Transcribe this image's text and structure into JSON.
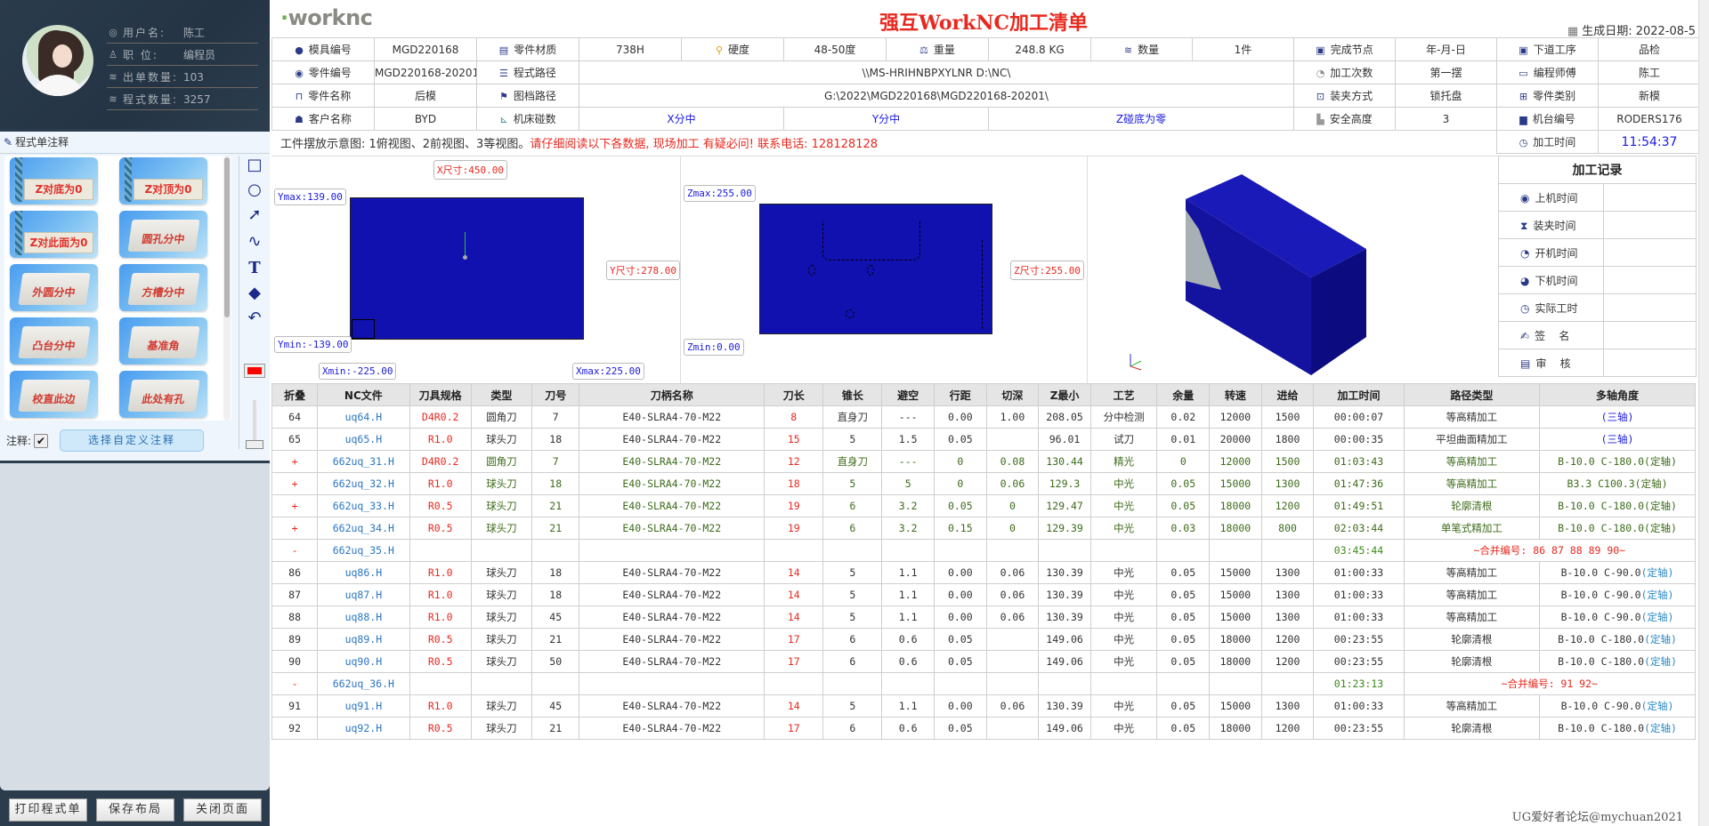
{
  "profile": {
    "username_label": "用户名:",
    "username": "陈工",
    "position_label": "职 位:",
    "position": "编程员",
    "order_count_label": "出单数量:",
    "order_count": "103",
    "program_count_label": "程式数量:",
    "program_count": "3257"
  },
  "annotations": {
    "title": "程式单注释",
    "cards": [
      {
        "label": "Z对底为0",
        "style": "tool"
      },
      {
        "label": "Z对顶为0",
        "style": "tool"
      },
      {
        "label": "Z对此面为0",
        "style": "tool"
      },
      {
        "label": "圆孔分中",
        "style": "block"
      },
      {
        "label": "外圆分中",
        "style": "block"
      },
      {
        "label": "方槽分中",
        "style": "block"
      },
      {
        "label": "凸台分中",
        "style": "block"
      },
      {
        "label": "基准角",
        "style": "block"
      },
      {
        "label": "校直此边",
        "style": "block"
      },
      {
        "label": "此处有孔",
        "style": "block"
      }
    ],
    "tools": [
      "rectangle-icon",
      "circle-icon",
      "arrow-icon",
      "curve-icon",
      "text-icon",
      "eraser-icon",
      "undo-icon"
    ],
    "pen_color": "#ff0000",
    "toggle_label": "注释:",
    "toggle_checked": true,
    "custom_button": "选择自定义注释"
  },
  "left_buttons": {
    "print": "打印程式单",
    "save_layout": "保存布局",
    "close_page": "关闭页面"
  },
  "header": {
    "logo": "worknc",
    "title": "强互WorkNC加工清单",
    "gen_date_label": "生成日期:",
    "gen_date": "2022-08-5"
  },
  "info": {
    "mold_no_label": "模具编号",
    "mold_no": "MGD220168",
    "material_label": "零件材质",
    "material": "738H",
    "hardness_label": "硬度",
    "hardness": "48-50度",
    "weight_label": "重量",
    "weight": "248.8 KG",
    "quantity_label": "数量",
    "quantity": "1件",
    "finish_node_label": "完成节点",
    "finish_node": "年-月-日",
    "next_process_label": "下道工序",
    "next_process": "品检",
    "part_no_label": "零件编号",
    "part_no": "MGD220168-20201",
    "program_path_label": "程式路径",
    "program_path": "\\\\MS-HRIHNBPXYLNR D:\\NC\\",
    "machining_count_label": "加工次数",
    "machining_count": "第一摆",
    "programmer_label": "编程师傅",
    "programmer": "陈工",
    "part_name_label": "零件名称",
    "part_name": "后模",
    "drawing_path_label": "图档路径",
    "drawing_path": "G:\\2022\\MGD220168\\MGD220168-20201\\",
    "clamping_label": "装夹方式",
    "clamping": "锁托盘",
    "part_type_label": "零件类别",
    "part_type": "新模",
    "customer_label": "客户名称",
    "customer": "BYD",
    "machine_coord_label": "机床碰数",
    "x_center": "X分中",
    "y_center": "Y分中",
    "z_zero": "Z碰底为零",
    "safe_height_label": "安全高度",
    "safe_height": "3",
    "machine_no_label": "机台编号",
    "machine_no": "RODERS176",
    "machining_time_label": "加工时间",
    "machining_time": "11:54:37"
  },
  "notes": {
    "prefix": "工件摆放示意图: 1俯视图、2前视图、3等视图。",
    "warning": "请仔细阅读以下各数据, 现场加工 有疑必问! 联系电话: 128128128"
  },
  "views": {
    "top": {
      "x_size": "X尺寸:450.00",
      "y_size": "Y尺寸:278.00",
      "ymax": "Ymax:139.00",
      "ymin": "Ymin:-139.00",
      "xmin": "Xmin:-225.00",
      "xmax": "Xmax:225.00"
    },
    "front": {
      "zmax": "Zmax:255.00",
      "zmin": "Zmin:0.00",
      "z_size": "Z尺寸:255.00"
    }
  },
  "record": {
    "title": "加工记录",
    "items": [
      {
        "icon": "radio-icon",
        "label": "上机时间"
      },
      {
        "icon": "hourglass-icon",
        "label": "装夹时间"
      },
      {
        "icon": "clock-start-icon",
        "label": "开机时间"
      },
      {
        "icon": "clock-end-icon",
        "label": "下机时间"
      },
      {
        "icon": "timer-icon",
        "label": "实际工时"
      },
      {
        "icon": "sign-icon",
        "label": "签    名"
      },
      {
        "icon": "review-icon",
        "label": "审    核"
      }
    ]
  },
  "ops": {
    "columns": [
      "折叠",
      "NC文件",
      "刀具规格",
      "类型",
      "刀号",
      "刀柄名称",
      "刀长",
      "锥长",
      "避空",
      "行距",
      "切深",
      "Z最小",
      "工艺",
      "余量",
      "转速",
      "进给",
      "加工时间",
      "路径类型",
      "多轴角度"
    ],
    "rows": [
      {
        "kind": "op",
        "fold": "64",
        "file": "uq64.H",
        "spec": "D4R0.2",
        "type": "圆角刀",
        "tool": "7",
        "holder": "E40-SLRA4-70-M22",
        "len": "8",
        "taper": "直身刀",
        "clear": "---",
        "step": "0.00",
        "depth": "1.00",
        "zmin": "208.05",
        "proc": "分中检测",
        "stock": "0.02",
        "speed": "12000",
        "feed": "1500",
        "time": "00:00:07",
        "path": "等高精加工",
        "axis": "",
        "axis_note": "(三轴)"
      },
      {
        "kind": "op",
        "fold": "65",
        "file": "uq65.H",
        "spec": "R1.0",
        "type": "球头刀",
        "tool": "18",
        "holder": "E40-SLRA4-70-M22",
        "len": "15",
        "taper": "5",
        "clear": "1.5",
        "step": "0.05",
        "depth": "",
        "zmin": "96.01",
        "proc": "试刀",
        "stock": "0.01",
        "speed": "20000",
        "feed": "1800",
        "time": "00:00:35",
        "path": "平坦曲面精加工",
        "axis": "",
        "axis_note": "(三轴)"
      },
      {
        "kind": "plus",
        "fold": "+",
        "file": "662uq_31.H",
        "spec": "D4R0.2",
        "type": "圆角刀",
        "tool": "7",
        "holder": "E40-SLRA4-70-M22",
        "len": "12",
        "taper": "直身刀",
        "clear": "---",
        "step": "0",
        "depth": "0.08",
        "zmin": "130.44",
        "proc": "精光",
        "stock": "0",
        "speed": "12000",
        "feed": "1500",
        "time": "01:03:43",
        "path": "等高精加工",
        "axis": "B-10.0 C-180.0(定轴)",
        "axis_note": ""
      },
      {
        "kind": "plus",
        "fold": "+",
        "file": "662uq_32.H",
        "spec": "R1.0",
        "type": "球头刀",
        "tool": "18",
        "holder": "E40-SLRA4-70-M22",
        "len": "18",
        "taper": "5",
        "clear": "5",
        "step": "0",
        "depth": "0.06",
        "zmin": "129.3",
        "proc": "中光",
        "stock": "0.05",
        "speed": "15000",
        "feed": "1300",
        "time": "01:47:36",
        "path": "等高精加工",
        "axis": "B3.3 C100.3(定轴)",
        "axis_note": ""
      },
      {
        "kind": "plus",
        "fold": "+",
        "file": "662uq_33.H",
        "spec": "R0.5",
        "type": "球头刀",
        "tool": "21",
        "holder": "E40-SLRA4-70-M22",
        "len": "19",
        "taper": "6",
        "clear": "3.2",
        "step": "0.05",
        "depth": "0",
        "zmin": "129.47",
        "proc": "中光",
        "stock": "0.05",
        "speed": "18000",
        "feed": "1200",
        "time": "01:49:51",
        "path": "轮廓清根",
        "axis": "B-10.0 C-180.0(定轴)",
        "axis_note": ""
      },
      {
        "kind": "plus",
        "fold": "+",
        "file": "662uq_34.H",
        "spec": "R0.5",
        "type": "球头刀",
        "tool": "21",
        "holder": "E40-SLRA4-70-M22",
        "len": "19",
        "taper": "6",
        "clear": "3.2",
        "step": "0.15",
        "depth": "0",
        "zmin": "129.39",
        "proc": "中光",
        "stock": "0.03",
        "speed": "18000",
        "feed": "800",
        "time": "02:03:44",
        "path": "单笔式精加工",
        "axis": "B-10.0 C-180.0(定轴)",
        "axis_note": ""
      },
      {
        "kind": "group",
        "fold": "-",
        "file": "662uq_35.H",
        "time": "03:45:44",
        "merge": "~合并编号: 86 87 88 89 90~"
      },
      {
        "kind": "op",
        "fold": "86",
        "file": "uq86.H",
        "spec": "R1.0",
        "type": "球头刀",
        "tool": "18",
        "holder": "E40-SLRA4-70-M22",
        "len": "14",
        "taper": "5",
        "clear": "1.1",
        "step": "0.00",
        "depth": "0.06",
        "zmin": "130.39",
        "proc": "中光",
        "stock": "0.05",
        "speed": "15000",
        "feed": "1300",
        "time": "01:00:33",
        "path": "等高精加工",
        "axis": "B-10.0 C-90.0",
        "axis_note": "(定轴)"
      },
      {
        "kind": "op",
        "fold": "87",
        "file": "uq87.H",
        "spec": "R1.0",
        "type": "球头刀",
        "tool": "18",
        "holder": "E40-SLRA4-70-M22",
        "len": "14",
        "taper": "5",
        "clear": "1.1",
        "step": "0.00",
        "depth": "0.06",
        "zmin": "130.39",
        "proc": "中光",
        "stock": "0.05",
        "speed": "15000",
        "feed": "1300",
        "time": "01:00:33",
        "path": "等高精加工",
        "axis": "B-10.0 C-90.0",
        "axis_note": "(定轴)"
      },
      {
        "kind": "op",
        "fold": "88",
        "file": "uq88.H",
        "spec": "R1.0",
        "type": "球头刀",
        "tool": "45",
        "holder": "E40-SLRA4-70-M22",
        "len": "14",
        "taper": "5",
        "clear": "1.1",
        "step": "0.00",
        "depth": "0.06",
        "zmin": "130.39",
        "proc": "中光",
        "stock": "0.05",
        "speed": "15000",
        "feed": "1300",
        "time": "01:00:33",
        "path": "等高精加工",
        "axis": "B-10.0 C-90.0",
        "axis_note": "(定轴)"
      },
      {
        "kind": "op",
        "fold": "89",
        "file": "uq89.H",
        "spec": "R0.5",
        "type": "球头刀",
        "tool": "21",
        "holder": "E40-SLRA4-70-M22",
        "len": "17",
        "taper": "6",
        "clear": "0.6",
        "step": "0.05",
        "depth": "",
        "zmin": "149.06",
        "proc": "中光",
        "stock": "0.05",
        "speed": "18000",
        "feed": "1200",
        "time": "00:23:55",
        "path": "轮廓清根",
        "axis": "B-10.0 C-180.0",
        "axis_note": "(定轴)"
      },
      {
        "kind": "op",
        "fold": "90",
        "file": "uq90.H",
        "spec": "R0.5",
        "type": "球头刀",
        "tool": "50",
        "holder": "E40-SLRA4-70-M22",
        "len": "17",
        "taper": "6",
        "clear": "0.6",
        "step": "0.05",
        "depth": "",
        "zmin": "149.06",
        "proc": "中光",
        "stock": "0.05",
        "speed": "18000",
        "feed": "1200",
        "time": "00:23:55",
        "path": "轮廓清根",
        "axis": "B-10.0 C-180.0",
        "axis_note": "(定轴)"
      },
      {
        "kind": "group",
        "fold": "-",
        "file": "662uq_36.H",
        "time": "01:23:13",
        "merge": "~合并编号: 91 92~"
      },
      {
        "kind": "op",
        "fold": "91",
        "file": "uq91.H",
        "spec": "R1.0",
        "type": "球头刀",
        "tool": "45",
        "holder": "E40-SLRA4-70-M22",
        "len": "14",
        "taper": "5",
        "clear": "1.1",
        "step": "0.00",
        "depth": "0.06",
        "zmin": "130.39",
        "proc": "中光",
        "stock": "0.05",
        "speed": "15000",
        "feed": "1300",
        "time": "01:00:33",
        "path": "等高精加工",
        "axis": "B-10.0 C-90.0",
        "axis_note": "(定轴)"
      },
      {
        "kind": "op",
        "fold": "92",
        "file": "uq92.H",
        "spec": "R0.5",
        "type": "球头刀",
        "tool": "21",
        "holder": "E40-SLRA4-70-M22",
        "len": "17",
        "taper": "6",
        "clear": "0.6",
        "step": "0.05",
        "depth": "",
        "zmin": "149.06",
        "proc": "中光",
        "stock": "0.05",
        "speed": "18000",
        "feed": "1200",
        "time": "00:23:55",
        "path": "轮廓清根",
        "axis": "B-10.0 C-180.0",
        "axis_note": "(定轴)"
      }
    ]
  },
  "watermark": "UG爱好者论坛@mychuan2021",
  "colors": {
    "title_red": "#e8281e",
    "link_blue": "#2b76c2",
    "value_blue": "#1a1ae0",
    "panel_dark": "#2b3c4d",
    "model_blue": "#1111b0"
  }
}
